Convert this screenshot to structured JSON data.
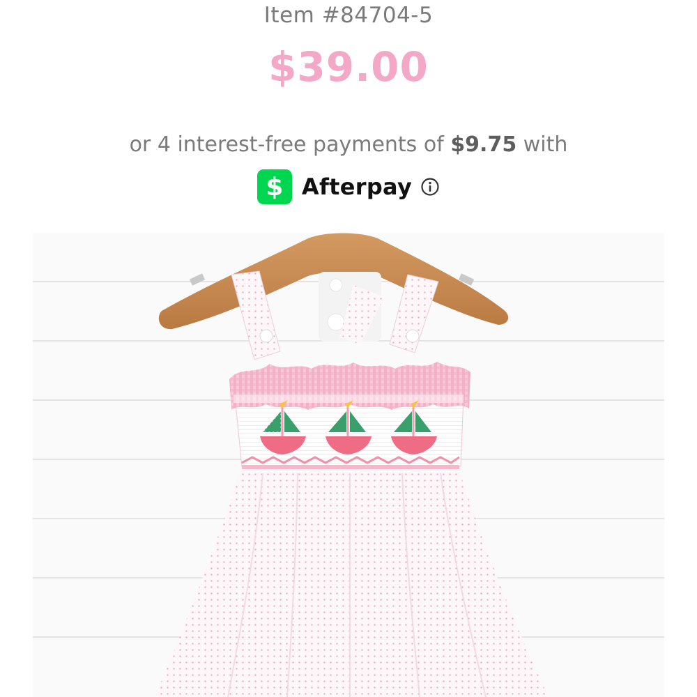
{
  "product": {
    "item_number": "Item #84704-5",
    "price": "$39.00"
  },
  "payment": {
    "prefix": "or 4 interest-free payments of ",
    "amount": "$9.75",
    "suffix": " with",
    "provider_logo_glyph": "$",
    "provider_name": "Afterpay",
    "info_icon": "info-circle-icon"
  },
  "colors": {
    "price": "#f3a8c8",
    "muted_text": "#7a7a7a",
    "cash_logo": "#00d64f"
  },
  "image": {
    "subject": "product-photo"
  }
}
